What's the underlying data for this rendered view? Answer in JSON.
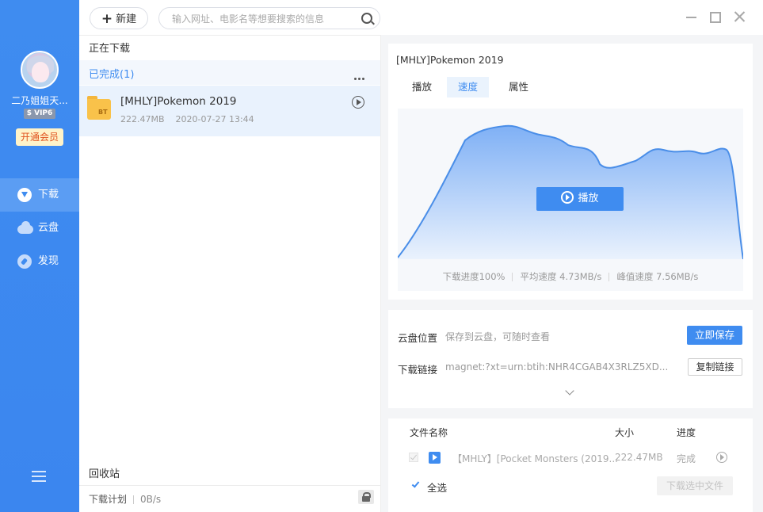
{
  "sidebar": {
    "username": "二乃姐姐天...",
    "vip_badge": "$ VIP6",
    "open_vip": "开通会员",
    "nav": [
      {
        "label": "下载",
        "icon": "download-icon",
        "active": true
      },
      {
        "label": "云盘",
        "icon": "cloud-icon",
        "active": false
      },
      {
        "label": "发现",
        "icon": "discover-icon",
        "active": false
      }
    ],
    "menu_icon": "hamburger-menu-icon"
  },
  "toolbar": {
    "new_label": "新建",
    "search_placeholder": "输入网址、电影名等想要搜索的信息",
    "search_icon": "search-icon"
  },
  "list": {
    "downloading_label": "正在下载",
    "completed_label": "已完成(1)",
    "items": [
      {
        "name": "[MHLY]Pokemon 2019",
        "size": "222.47MB",
        "date": "2020-07-27 13:44",
        "folder_tag": "BT"
      }
    ],
    "recycle_label": "回收站",
    "plan_label": "下载计划",
    "plan_speed": "0B/s"
  },
  "detail": {
    "title": "[MHLY]Pokemon 2019",
    "tabs": [
      "播放",
      "速度",
      "属性"
    ],
    "active_tab": "速度",
    "play_button": "播放",
    "stats": {
      "progress": "下载进度100%",
      "avg_speed": "平均速度 4.73MB/s",
      "peak_speed": "峰值速度 7.56MB/s"
    },
    "accent_color": "#3f8cf0"
  },
  "cloud": {
    "location_label": "云盘位置",
    "location_value": "保存到云盘，可随时查看",
    "save_button": "立即保存",
    "link_label": "下载链接",
    "link_value": "magnet:?xt=urn:btih:NHR4CGAB4X3RLZ5XD...",
    "copy_button": "复制链接"
  },
  "files": {
    "headers": {
      "name": "文件名称",
      "size": "大小",
      "progress": "进度"
    },
    "rows": [
      {
        "name": "【MHLY】[Pocket Monsters (2019...",
        "size": "222.47MB",
        "progress": "完成"
      }
    ],
    "select_all": "全选",
    "download_selected": "下载选中文件"
  }
}
